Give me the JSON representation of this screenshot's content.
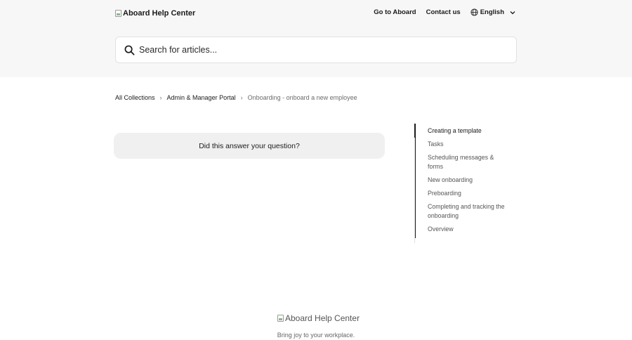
{
  "header": {
    "logo_alt": "Aboard Help Center",
    "nav": {
      "go_to": "Go to Aboard",
      "contact": "Contact us",
      "language": "English"
    },
    "search": {
      "placeholder": "Search for articles..."
    }
  },
  "breadcrumb": {
    "items": [
      "All Collections",
      "Admin & Manager Portal"
    ],
    "current": "Onboarding - onboard a new employee"
  },
  "feedback": {
    "question": "Did this answer your question?"
  },
  "toc": {
    "items": [
      "Creating a template",
      "Tasks",
      "Scheduling messages & forms",
      "New onboarding",
      "Preboarding",
      "Completing and tracking the onboarding",
      "Overview"
    ]
  },
  "footer": {
    "logo_alt": "Aboard Help Center",
    "tagline": "Bring joy to your workplace."
  }
}
